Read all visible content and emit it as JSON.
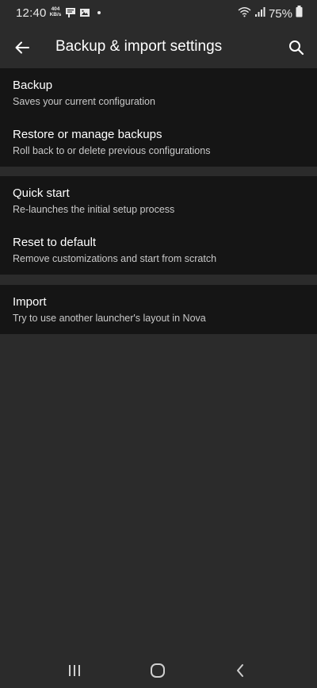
{
  "status_bar": {
    "time": "12:40",
    "speed_value": "404",
    "speed_unit": "KB/s",
    "battery_percent": "75%",
    "icons": [
      "data-speed-indicator",
      "message-icon",
      "image-icon",
      "notification-dot",
      "wifi-icon",
      "signal-icon",
      "battery-icon"
    ]
  },
  "header": {
    "title": "Backup & import settings",
    "back_icon": "arrow-left-icon",
    "search_icon": "search-icon"
  },
  "groups": [
    {
      "items": [
        {
          "title": "Backup",
          "subtitle": "Saves your current configuration"
        },
        {
          "title": "Restore or manage backups",
          "subtitle": "Roll back to or delete previous configurations"
        }
      ]
    },
    {
      "items": [
        {
          "title": "Quick start",
          "subtitle": "Re-launches the initial setup process"
        },
        {
          "title": "Reset to default",
          "subtitle": "Remove customizations and start from scratch"
        }
      ]
    },
    {
      "items": [
        {
          "title": "Import",
          "subtitle": "Try to use another launcher's layout in Nova"
        }
      ]
    }
  ],
  "nav_bar": {
    "buttons": [
      "recent-apps-icon",
      "home-icon",
      "back-icon"
    ]
  },
  "colors": {
    "background": "#2b2b2b",
    "group_background": "#151515",
    "text_primary": "#ffffff",
    "text_secondary": "#c9c9c9"
  }
}
